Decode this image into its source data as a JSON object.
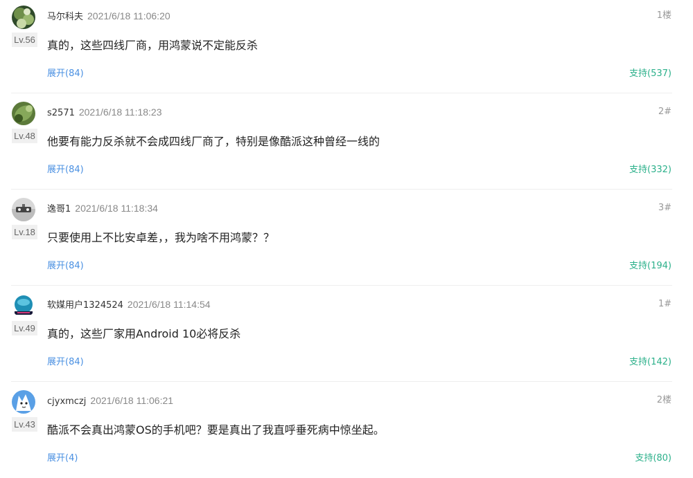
{
  "comments": [
    {
      "username": "马尔科夫",
      "time": "2021/6/18 11:06:20",
      "floor": "1楼",
      "level": "Lv.56",
      "content": "真的，这些四线厂商，用鸿蒙说不定能反杀",
      "expand": "展开(84)",
      "support": "支持(537)"
    },
    {
      "username": "s2571",
      "time": "2021/6/18 11:18:23",
      "floor": "2#",
      "level": "Lv.48",
      "content": "他要有能力反杀就不会成四线厂商了，特别是像酷派这种曾经一线的",
      "expand": "展开(84)",
      "support": "支持(332)"
    },
    {
      "username": "逸哥1",
      "time": "2021/6/18 11:18:34",
      "floor": "3#",
      "level": "Lv.18",
      "content": "只要使用上不比安卓差，，我为啥不用鸿蒙？？",
      "expand": "展开(84)",
      "support": "支持(194)"
    },
    {
      "username": "软媒用户1324524",
      "time": "2021/6/18 11:14:54",
      "floor": "1#",
      "level": "Lv.49",
      "content": "真的，这些厂家用Android 10必将反杀",
      "expand": "展开(84)",
      "support": "支持(142)"
    },
    {
      "username": "cjyxmczj",
      "time": "2021/6/18 11:06:21",
      "floor": "2楼",
      "level": "Lv.43",
      "content": "酷派不会真出鸿蒙OS的手机吧？要是真出了我直呼垂死病中惊坐起。",
      "expand": "展开(4)",
      "support": "支持(80)"
    }
  ]
}
